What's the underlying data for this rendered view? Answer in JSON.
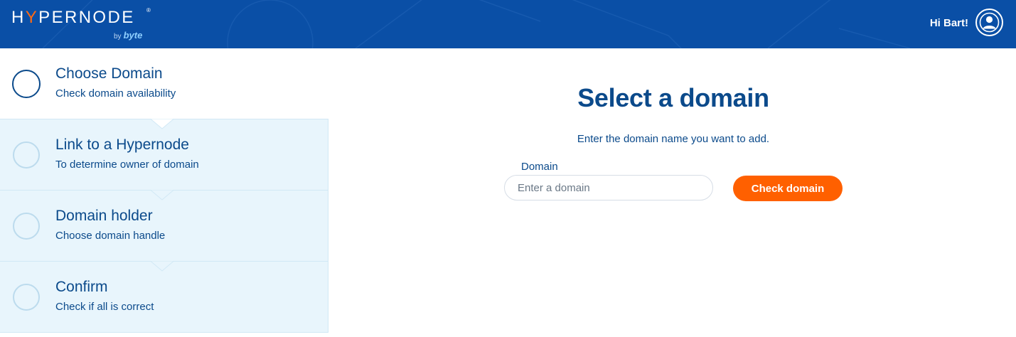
{
  "header": {
    "logo_text_pre": "H",
    "logo_text_y": "Y",
    "logo_text_post": "PERNODE",
    "logo_registered": "®",
    "logo_by": "by",
    "logo_byte": "byte",
    "greeting": "Hi Bart!",
    "avatar_icon": "user-circle-icon"
  },
  "steps": [
    {
      "title": "Choose Domain",
      "subtitle": "Check domain availability",
      "state": "active"
    },
    {
      "title": "Link to a Hypernode",
      "subtitle": "To determine owner of domain",
      "state": "inactive"
    },
    {
      "title": "Domain holder",
      "subtitle": "Choose domain handle",
      "state": "inactive"
    },
    {
      "title": "Confirm",
      "subtitle": "Check if all is correct",
      "state": "inactive"
    }
  ],
  "main": {
    "title": "Select a domain",
    "description": "Enter the domain name you want to add.",
    "field_label": "Domain",
    "input_value": "",
    "input_placeholder": "Enter a domain",
    "button_label": "Check domain"
  },
  "colors": {
    "header_bg": "#0a4fa6",
    "brand_text": "#0b4a8b",
    "accent_orange": "#ff6000",
    "step_inactive_bg": "#e8f5fc"
  }
}
